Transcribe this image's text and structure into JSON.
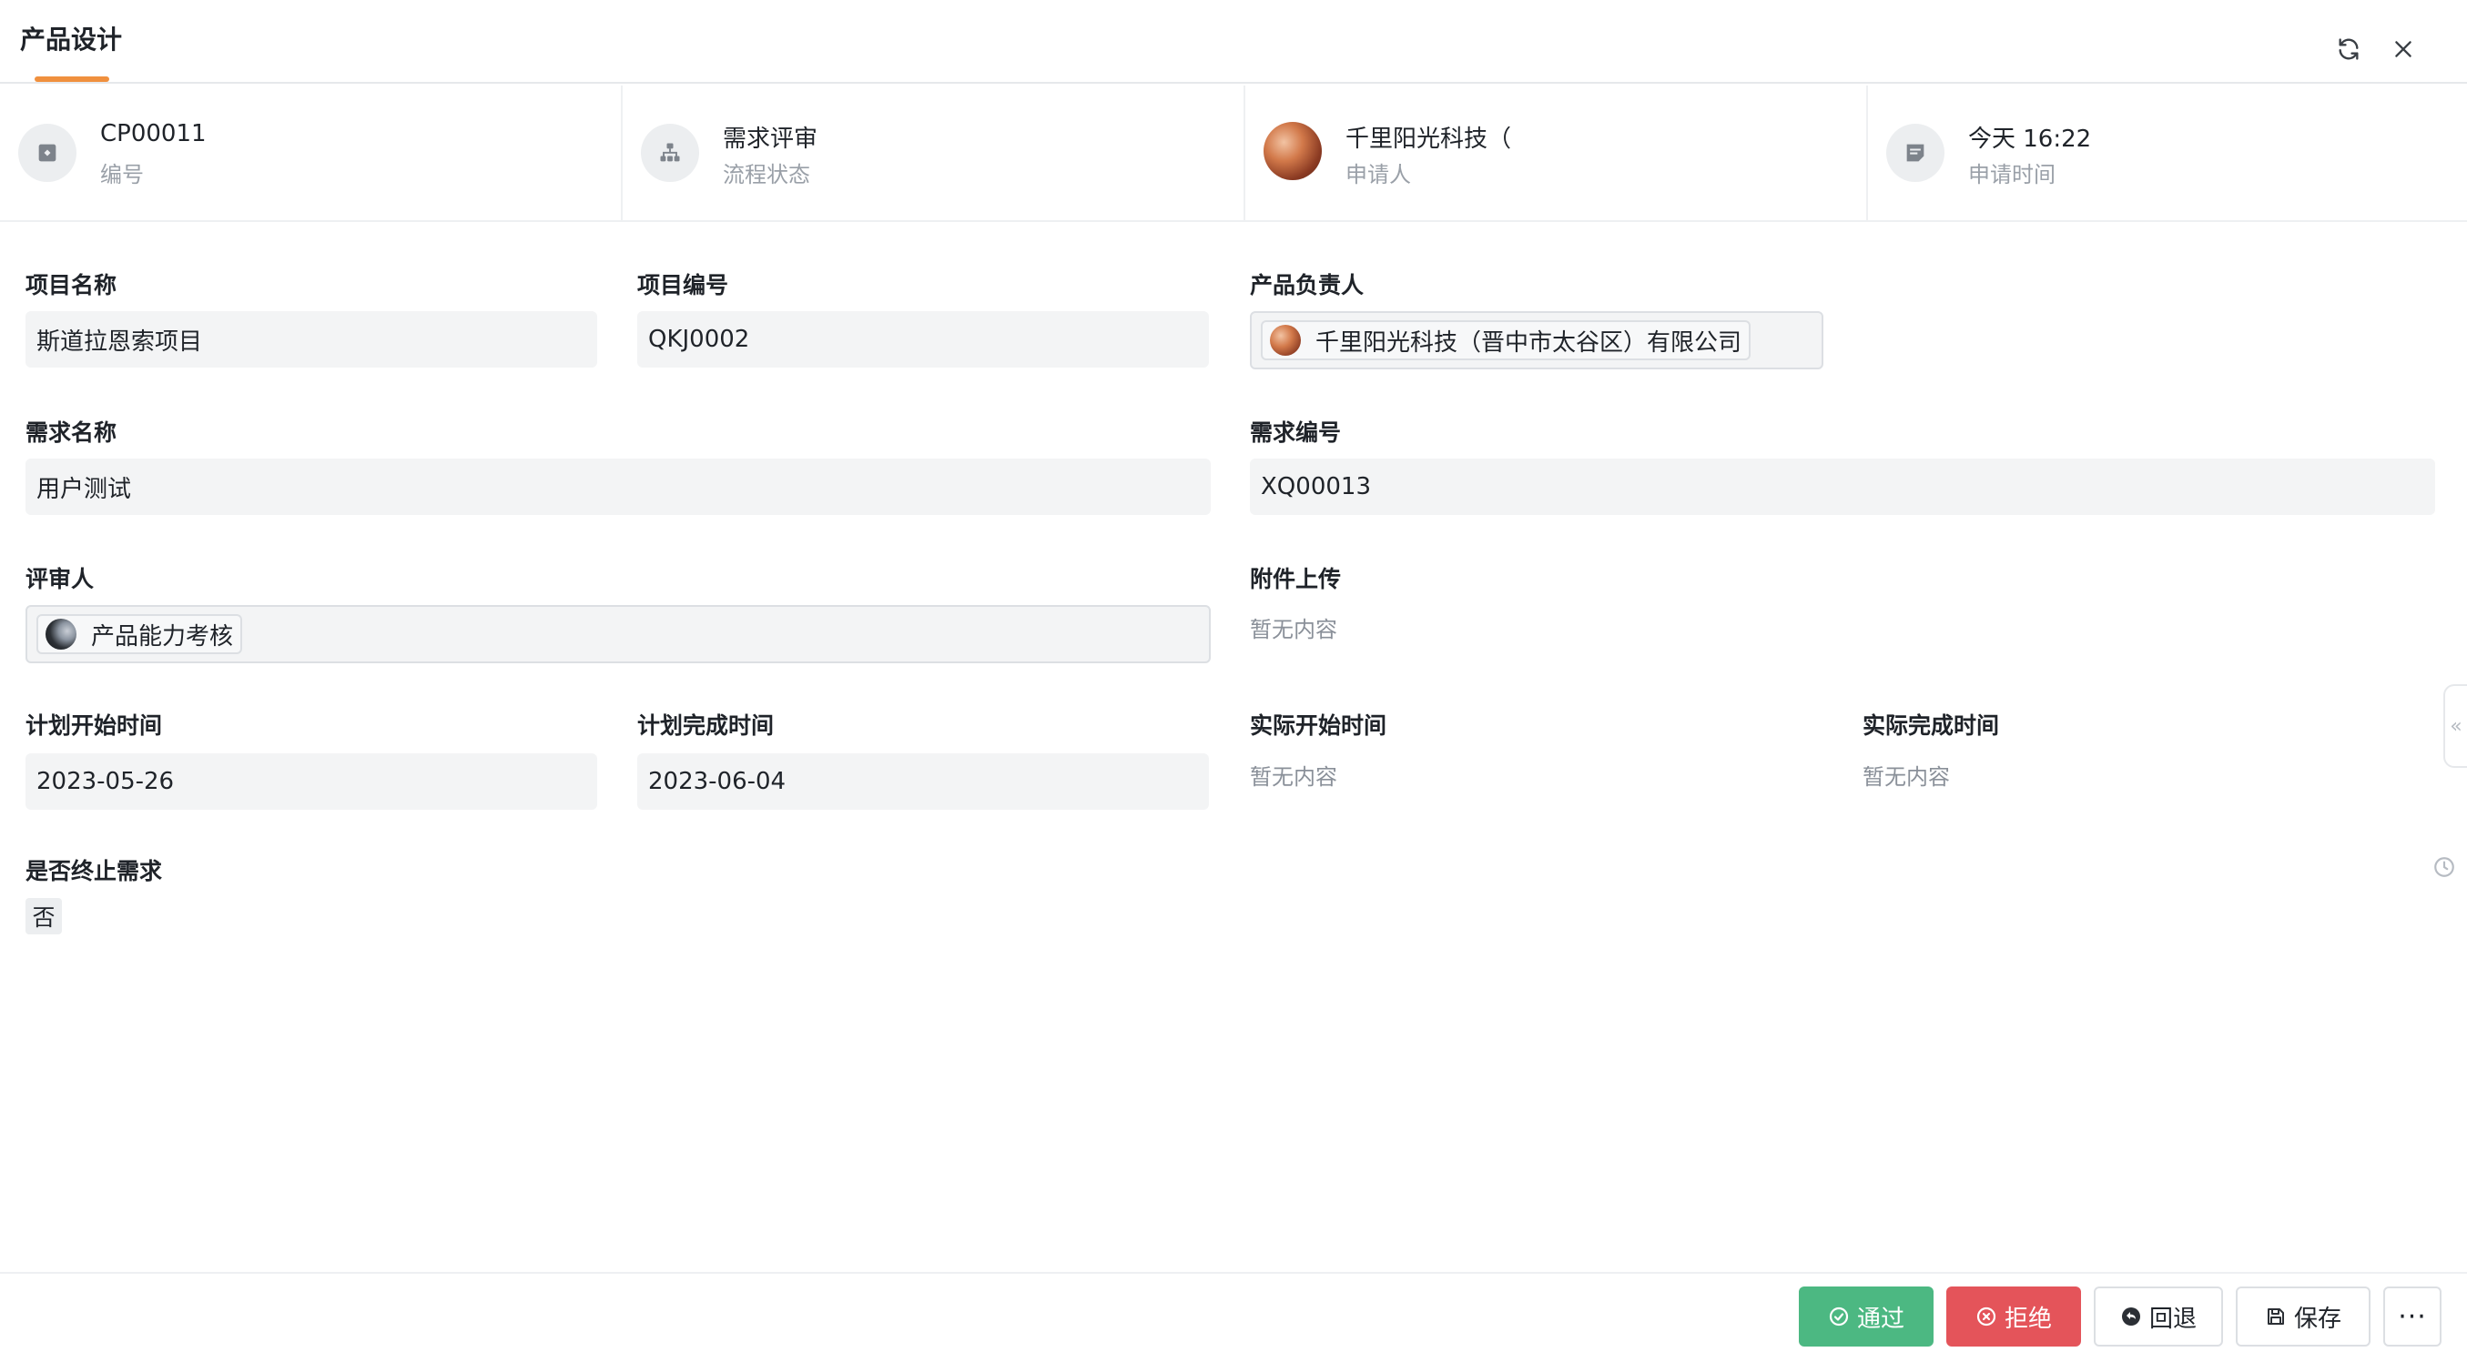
{
  "header": {
    "title": "产品设计"
  },
  "info": [
    {
      "value": "CP00011",
      "label": "编号",
      "icon": "tag-icon"
    },
    {
      "value": "需求评审",
      "label": "流程状态",
      "icon": "org-chart-icon"
    },
    {
      "value": "千里阳光科技（",
      "label": "申请人",
      "icon": "avatar"
    },
    {
      "value": "今天 16:22",
      "label": "申请时间",
      "icon": "note-icon"
    }
  ],
  "form": {
    "project_name": {
      "label": "项目名称",
      "value": "斯道拉恩索项目"
    },
    "project_code": {
      "label": "项目编号",
      "value": "QKJ0002"
    },
    "product_owner": {
      "label": "产品负责人",
      "value": "千里阳光科技（晋中市太谷区）有限公司"
    },
    "req_name": {
      "label": "需求名称",
      "value": "用户测试"
    },
    "req_code": {
      "label": "需求编号",
      "value": "XQ00013"
    },
    "reviewer": {
      "label": "评审人",
      "value": "产品能力考核"
    },
    "attachment": {
      "label": "附件上传",
      "empty": "暂无内容"
    },
    "plan_start": {
      "label": "计划开始时间",
      "value": "2023-05-26"
    },
    "plan_end": {
      "label": "计划完成时间",
      "value": "2023-06-04"
    },
    "actual_start": {
      "label": "实际开始时间",
      "empty": "暂无内容"
    },
    "actual_end": {
      "label": "实际完成时间",
      "empty": "暂无内容"
    },
    "terminate": {
      "label": "是否终止需求",
      "value": "否"
    }
  },
  "footer": {
    "approve": "通过",
    "reject": "拒绝",
    "back": "回退",
    "save": "保存",
    "more": "···"
  },
  "colors": {
    "accent": "#f0903e",
    "approve": "#4cb882",
    "reject": "#e4545a"
  }
}
